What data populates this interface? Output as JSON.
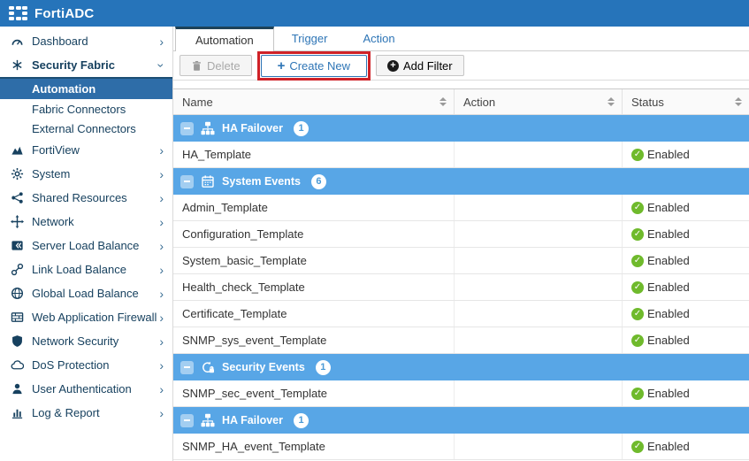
{
  "app": {
    "title": "FortiADC"
  },
  "colors": {
    "topbar_blue": "#2674ba",
    "accent_blue": "#2e75b6",
    "active_nav_blue": "#2e6da8",
    "group_row_blue": "#58a6e6",
    "status_green": "#6fba2c",
    "annotation_red": "#cf2127"
  },
  "sidebar": {
    "items": [
      {
        "label": "Dashboard",
        "icon": "dashboard-icon"
      },
      {
        "label": "Security Fabric",
        "icon": "security-fabric-icon",
        "children": [
          {
            "label": "Automation",
            "active": true
          },
          {
            "label": "Fabric Connectors"
          },
          {
            "label": "External Connectors"
          }
        ]
      },
      {
        "label": "FortiView",
        "icon": "fortiview-icon"
      },
      {
        "label": "System",
        "icon": "gear-icon"
      },
      {
        "label": "Shared Resources",
        "icon": "share-icon"
      },
      {
        "label": "Network",
        "icon": "network-icon"
      },
      {
        "label": "Server Load Balance",
        "icon": "server-load-balance-icon"
      },
      {
        "label": "Link Load Balance",
        "icon": "link-icon"
      },
      {
        "label": "Global Load Balance",
        "icon": "globe-icon"
      },
      {
        "label": "Web Application Firewall",
        "icon": "firewall-icon"
      },
      {
        "label": "Network Security",
        "icon": "shield-icon"
      },
      {
        "label": "DoS Protection",
        "icon": "cloud-icon"
      },
      {
        "label": "User Authentication",
        "icon": "user-icon"
      },
      {
        "label": "Log & Report",
        "icon": "bar-chart-icon"
      }
    ]
  },
  "tabs": [
    {
      "label": "Automation",
      "active": true
    },
    {
      "label": "Trigger"
    },
    {
      "label": "Action"
    }
  ],
  "toolbar": {
    "delete_label": "Delete",
    "create_new_label": "Create New",
    "add_filter_label": "Add Filter"
  },
  "table": {
    "columns": [
      "Name",
      "Action",
      "Status"
    ],
    "groups": [
      {
        "label": "HA Failover",
        "count": "1",
        "icon": "sitemap-icon",
        "rows": [
          {
            "name": "HA_Template",
            "action": "",
            "status": "Enabled"
          }
        ]
      },
      {
        "label": "System Events",
        "count": "6",
        "icon": "calendar-icon",
        "rows": [
          {
            "name": "Admin_Template",
            "action": "",
            "status": "Enabled"
          },
          {
            "name": "Configuration_Template",
            "action": "",
            "status": "Enabled"
          },
          {
            "name": "System_basic_Template",
            "action": "",
            "status": "Enabled"
          },
          {
            "name": "Health_check_Template",
            "action": "",
            "status": "Enabled"
          },
          {
            "name": "Certificate_Template",
            "action": "",
            "status": "Enabled"
          },
          {
            "name": "SNMP_sys_event_Template",
            "action": "",
            "status": "Enabled"
          }
        ]
      },
      {
        "label": "Security Events",
        "count": "1",
        "icon": "security-refresh-lock-icon",
        "rows": [
          {
            "name": "SNMP_sec_event_Template",
            "action": "",
            "status": "Enabled"
          }
        ]
      },
      {
        "label": "HA Failover",
        "count": "1",
        "icon": "sitemap-icon",
        "rows": [
          {
            "name": "SNMP_HA_event_Template",
            "action": "",
            "status": "Enabled"
          }
        ]
      }
    ]
  }
}
